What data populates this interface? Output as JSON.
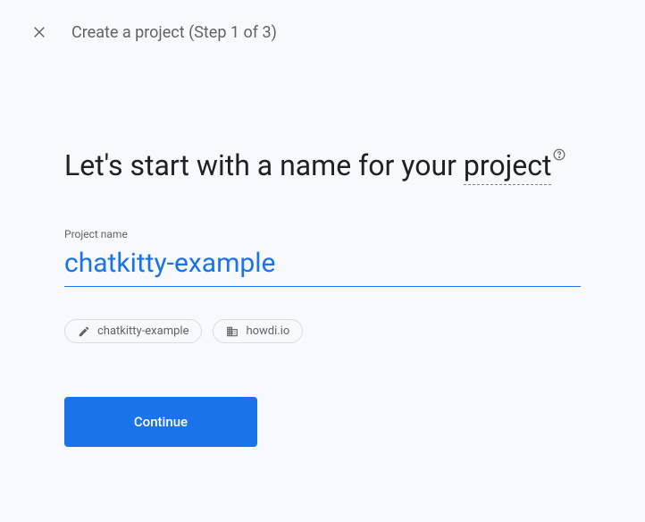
{
  "header": {
    "title": "Create a project (Step 1 of 3)"
  },
  "main": {
    "heading_prefix": "Let's start with a name for your ",
    "heading_underlined": "project",
    "field_label": "Project name",
    "field_value": "chatkitty-example"
  },
  "chips": [
    {
      "icon": "pencil-icon",
      "label": "chatkitty-example"
    },
    {
      "icon": "domain-icon",
      "label": "howdi.io"
    }
  ],
  "actions": {
    "continue_label": "Continue"
  },
  "colors": {
    "primary": "#1a73e8",
    "text_primary": "#202124",
    "text_secondary": "#5f6368",
    "background": "#f8f9fa",
    "border": "#dadce0"
  }
}
